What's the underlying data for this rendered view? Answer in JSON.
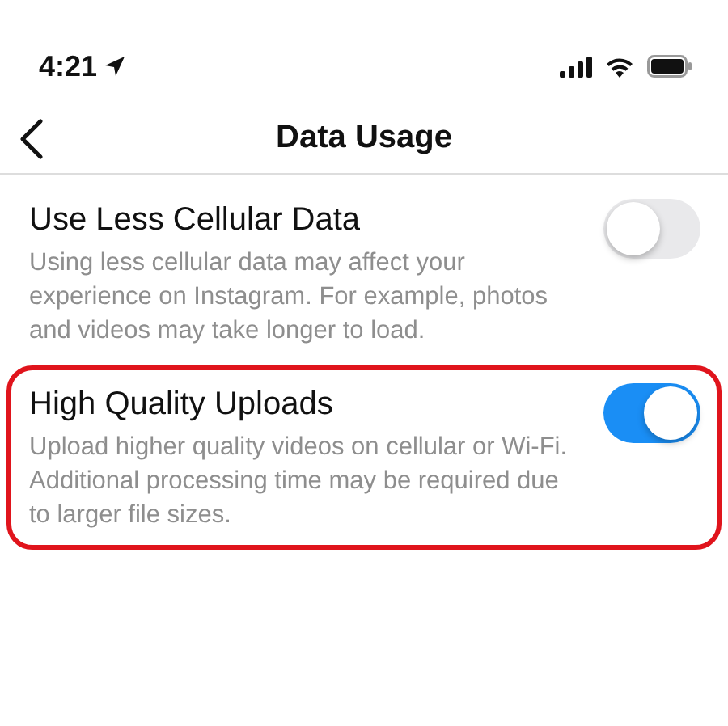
{
  "status_bar": {
    "time": "4:21"
  },
  "header": {
    "title": "Data Usage"
  },
  "settings": [
    {
      "title": "Use Less Cellular Data",
      "description": "Using less cellular data may affect your experience on Instagram. For example, photos and videos may take longer to load.",
      "on": false,
      "highlighted": false
    },
    {
      "title": "High Quality Uploads",
      "description": "Upload higher quality videos on cellular or Wi-Fi. Additional processing time may be required due to larger file sizes.",
      "on": true,
      "highlighted": true
    }
  ]
}
